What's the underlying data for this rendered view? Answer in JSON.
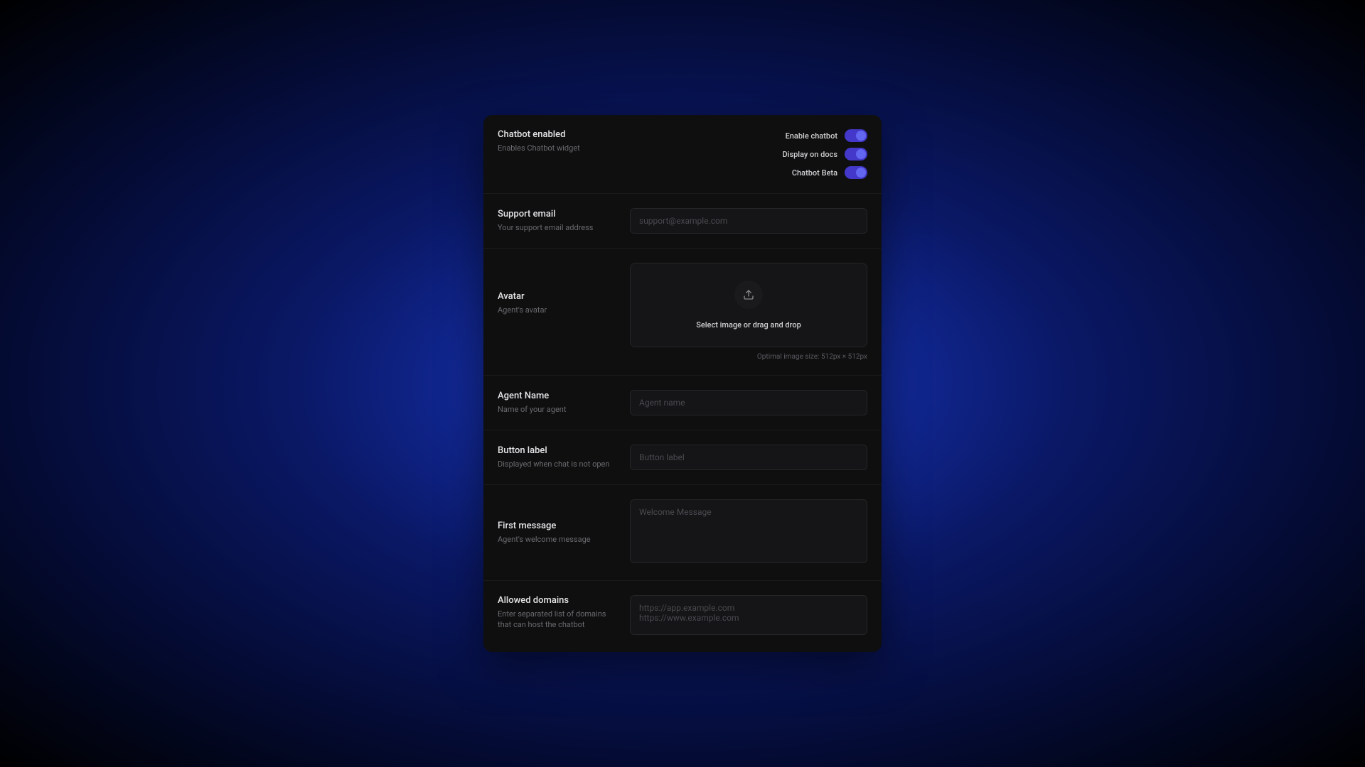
{
  "header": {
    "title": "Chatbot enabled",
    "desc": "Enables Chatbot widget",
    "toggles": [
      {
        "label": "Enable chatbot"
      },
      {
        "label": "Display on docs"
      },
      {
        "label": "Chatbot Beta"
      }
    ]
  },
  "support_email": {
    "title": "Support email",
    "desc": "Your support email address",
    "placeholder": "support@example.com"
  },
  "avatar": {
    "title": "Avatar",
    "desc": "Agent's avatar",
    "upload_text": "Select image or drag and drop",
    "hint": "Optimal image size: 512px × 512px"
  },
  "agent_name": {
    "title": "Agent Name",
    "desc": "Name of your agent",
    "placeholder": "Agent name"
  },
  "button_label": {
    "title": "Button label",
    "desc": "Displayed when chat is not open",
    "placeholder": "Button label"
  },
  "first_message": {
    "title": "First message",
    "desc": "Agent's welcome message",
    "placeholder": "Welcome Message"
  },
  "allowed_domains": {
    "title": "Allowed domains",
    "desc": "Enter separated list of domains that can host the chatbot",
    "placeholder": "https://app.example.com\nhttps://www.example.com"
  }
}
